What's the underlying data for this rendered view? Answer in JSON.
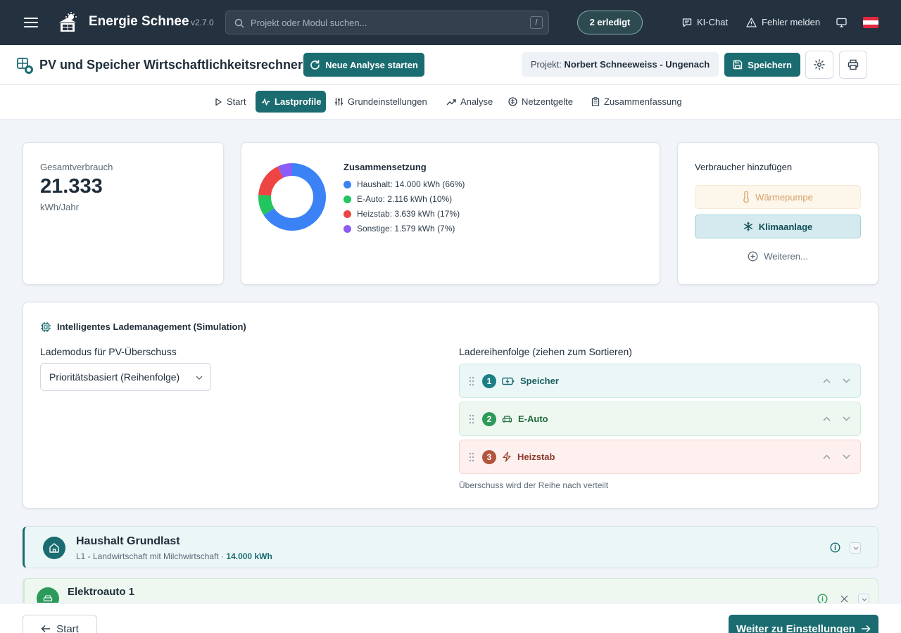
{
  "topbar": {
    "app_name": "Energie Schnee",
    "version": "v2.7.0",
    "search_placeholder": "Projekt oder Modul suchen...",
    "search_shortcut": "/",
    "status_badge": "2 erledigt",
    "ki_chat": "KI-Chat",
    "report_error": "Fehler melden"
  },
  "header": {
    "title": "PV und Speicher Wirtschaftlichkeitsrechner",
    "new_analysis": "Neue Analyse starten",
    "project_label": "Projekt:",
    "project_name": "Norbert Schneeweiss - Ungenach",
    "save": "Speichern"
  },
  "nav": {
    "tabs": [
      {
        "label": "Start"
      },
      {
        "label": "Lastprofile"
      },
      {
        "label": "Grundeinstellungen"
      },
      {
        "label": "Analyse"
      },
      {
        "label": "Netzentgelte"
      },
      {
        "label": "Zusammenfassung"
      }
    ],
    "active": "Lastprofile"
  },
  "total": {
    "label": "Gesamtverbrauch",
    "value": "21.333",
    "unit": "kWh/Jahr"
  },
  "composition": {
    "title": "Zusammensetzung",
    "items": [
      {
        "text": "Haushalt: 14.000 kWh (66%)",
        "value": 66,
        "color": "#3b82f6"
      },
      {
        "text": "E-Auto: 2.116 kWh (10%)",
        "value": 10,
        "color": "#22c55e"
      },
      {
        "text": "Heizstab: 3.639 kWh (17%)",
        "value": 17,
        "color": "#ef4444"
      },
      {
        "text": "Sonstige: 1.579 kWh (7%)",
        "value": 7,
        "color": "#8b5cf6"
      }
    ]
  },
  "add_consumer": {
    "title": "Verbraucher hinzufügen",
    "heat_pump": "Wärmepumpe",
    "ac": "Klimaanlage",
    "more": "Weiteren..."
  },
  "charging": {
    "title": "Intelligentes Lademanagement (Simulation)",
    "mode_label": "Lademodus für PV-Überschuss",
    "mode_value": "Prioritätsbasiert (Reihenfolge)",
    "order_label": "Ladereihenfolge (ziehen zum Sortieren)",
    "queue": [
      {
        "num": "1",
        "label": "Speicher"
      },
      {
        "num": "2",
        "label": "E-Auto"
      },
      {
        "num": "3",
        "label": "Heizstab"
      }
    ],
    "note": "Überschuss wird der Reihe nach verteilt"
  },
  "household": {
    "title": "Haushalt Grundlast",
    "subtitle": "L1 - Landwirtschaft mit Milchwirtschaft ·",
    "kwh": "14.000 kWh"
  },
  "ev": {
    "title": "Elektroauto 1"
  },
  "footer": {
    "back": "Start",
    "next": "Weiter zu Einstellungen"
  }
}
